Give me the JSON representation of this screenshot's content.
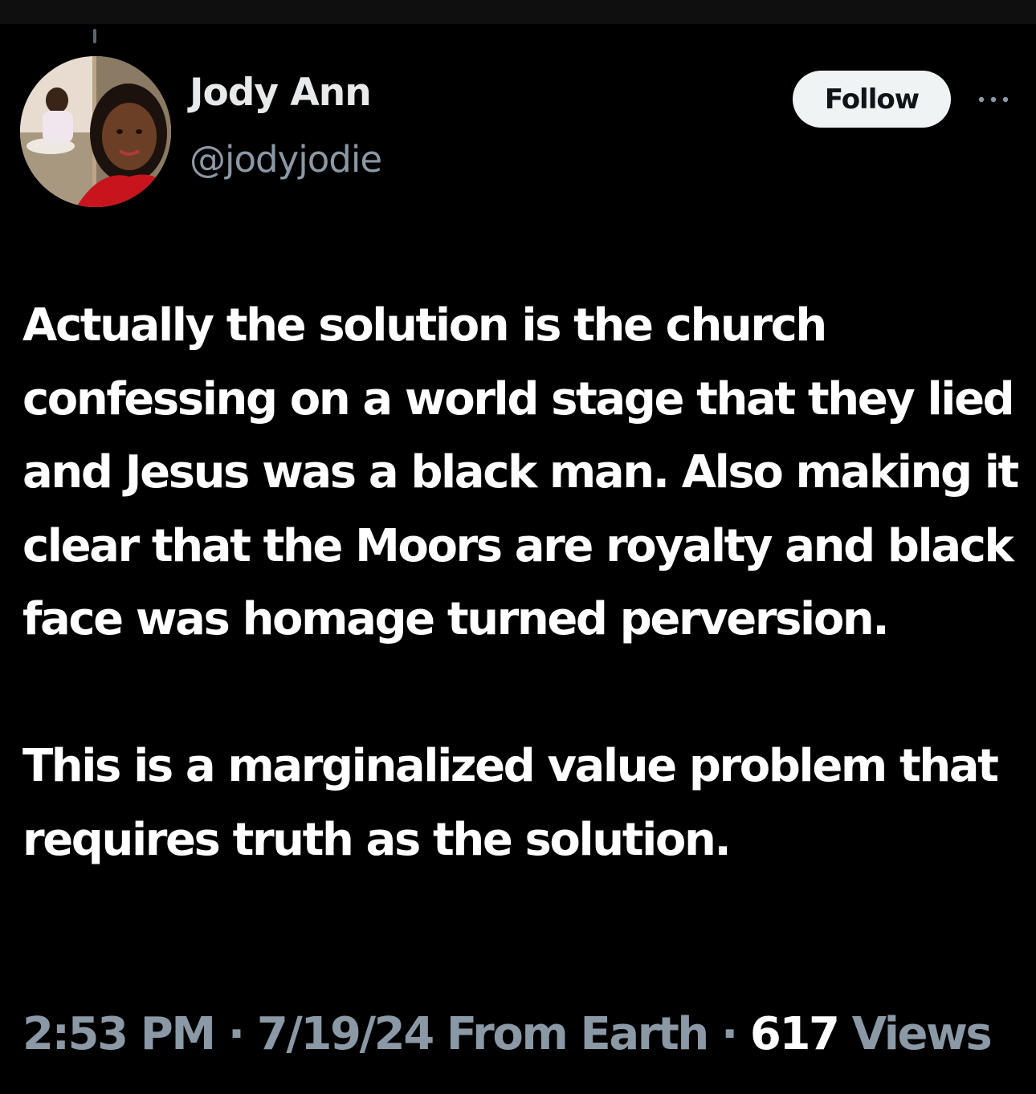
{
  "colors": {
    "background": "#000000",
    "text_primary": "#ffffff",
    "text_secondary": "#8b98a5",
    "follow_button_bg": "#eff3f4",
    "follow_button_text": "#0f1419"
  },
  "author": {
    "display_name": "Jody Ann",
    "handle": "@jodyjodie",
    "avatar_icon": "profile-photo"
  },
  "actions": {
    "follow_label": "Follow",
    "more_icon": "more-horizontal-icon"
  },
  "tweet": {
    "paragraphs": [
      "Actually the solution is the church confessing on a world stage that they lied and Jesus was a black man. Also making it clear that the Moors are royalty and black face was homage turned perversion.",
      "This is a marginalized value problem that requires truth as the solution."
    ]
  },
  "meta": {
    "time": "2:53 PM",
    "separator": "·",
    "date": "7/19/24",
    "source": "From Earth",
    "views_count": "617",
    "views_label": "Views"
  }
}
